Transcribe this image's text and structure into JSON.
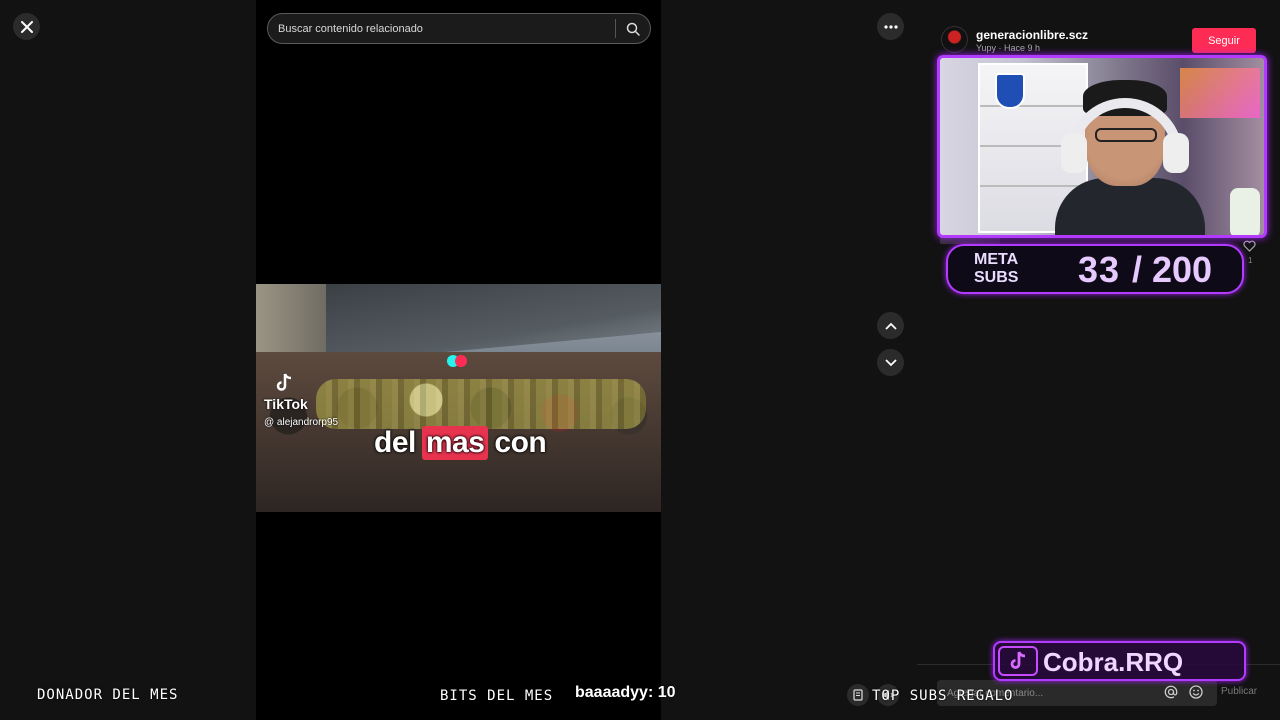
{
  "viewer": {
    "close_label": "close",
    "search": {
      "placeholder": "Buscar contenido relacionado"
    }
  },
  "video": {
    "watermark_brand": "TikTok",
    "watermark_handle": "@ alejandrorp95",
    "caption_parts": [
      "del",
      "mas",
      "con"
    ]
  },
  "post": {
    "author": "generacionlibre.scz",
    "subline": "Yupy · Hace 9 h",
    "follow_label": "Seguir",
    "like_count": "1"
  },
  "comment": {
    "placeholder": "Agregar comentario...",
    "publish_label": "Publicar"
  },
  "overlay": {
    "meta_label_1": "META",
    "meta_label_2": "SUBS",
    "meta_current": "33",
    "meta_total": "/ 200",
    "meta_progress": 0.165,
    "donor_label": "DONADOR DEL MES",
    "bits_label": "BITS DEL MES",
    "bits_value": "baaaadyy: 10",
    "top_subs_label": "TOP SUBS REGALO",
    "channel_name": "Cobra.RRQ"
  },
  "colors": {
    "accent_pink": "#fe2c55",
    "overlay_purple": "#b23bff",
    "tiktok_cyan": "#25f4ee",
    "tiktok_red": "#fe2c55"
  },
  "icons": [
    "close-icon",
    "search-icon",
    "more-icon",
    "chevron-up-icon",
    "chevron-down-icon",
    "heart-icon",
    "mention-icon",
    "emoji-icon",
    "tiktok-logo-icon"
  ]
}
